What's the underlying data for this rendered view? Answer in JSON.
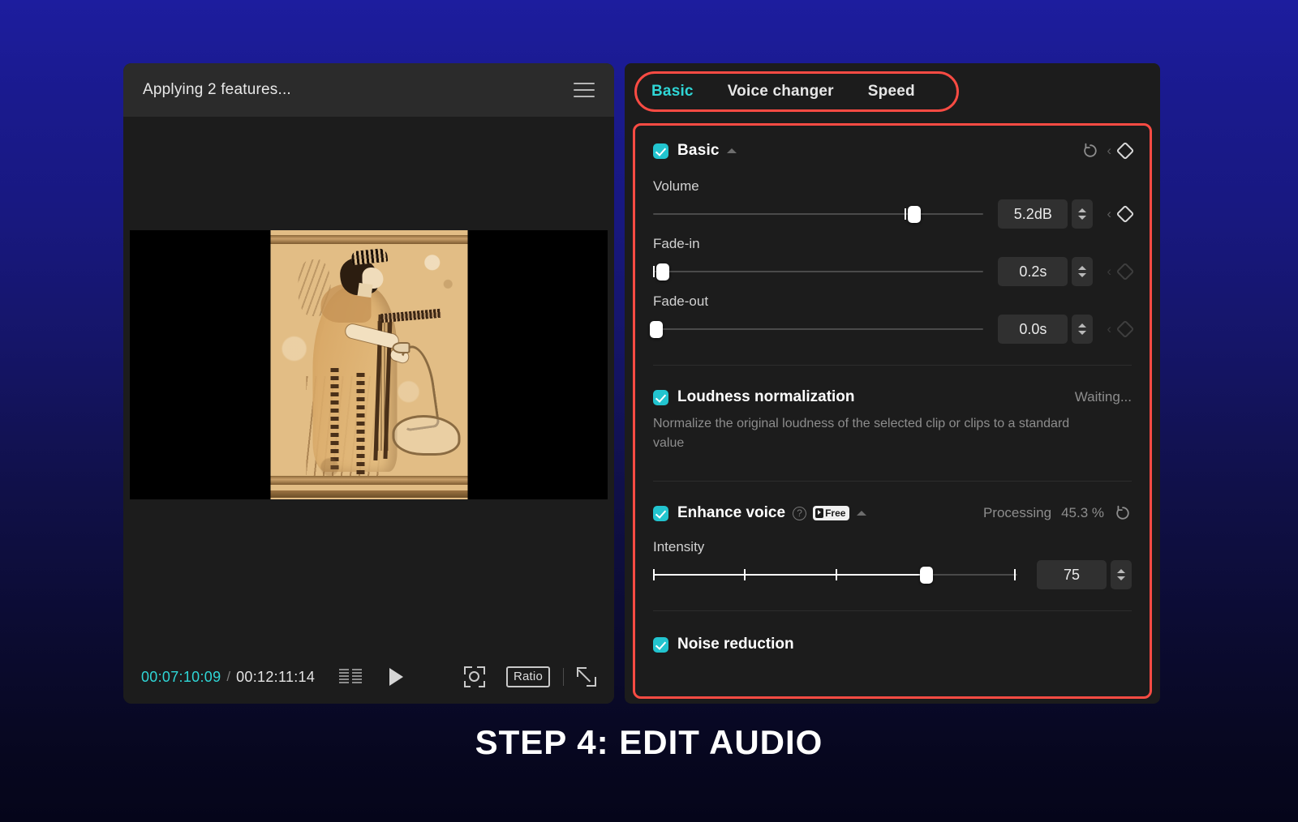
{
  "caption": "STEP 4: EDIT AUDIO",
  "player": {
    "title": "Applying 2 features...",
    "menu_icon": "hamburger-menu-icon",
    "current_time": "00:07:10:09",
    "time_separator": "/",
    "total_time": "00:12:11:14",
    "grid_icon": "grid-view-icon",
    "play_icon": "play-icon",
    "snapshot_icon": "snapshot-zoom-icon",
    "ratio_label": "Ratio",
    "fullscreen_icon": "fullscreen-expand-icon"
  },
  "properties": {
    "tabs": [
      {
        "label": "Basic",
        "active": true
      },
      {
        "label": "Voice changer",
        "active": false
      },
      {
        "label": "Speed",
        "active": false
      }
    ],
    "basic_section": {
      "title": "Basic",
      "checked": true,
      "collapse_icon": "caret-up-icon",
      "reset_icon": "reset-icon",
      "prev_keyframe_icon": "chevron-left-icon",
      "keyframe_icon": "keyframe-diamond-icon"
    },
    "controls": [
      {
        "label": "Volume",
        "value": "5.2dB",
        "slider_percent": 79,
        "tick_percent": 76,
        "keyframe_active": true
      },
      {
        "label": "Fade-in",
        "value": "0.2s",
        "slider_percent": 3,
        "tick_percent": 0,
        "keyframe_active": false
      },
      {
        "label": "Fade-out",
        "value": "0.0s",
        "slider_percent": 0,
        "tick_percent": 0,
        "keyframe_active": false
      }
    ],
    "loudness": {
      "title": "Loudness normalization",
      "checked": true,
      "status": "Waiting...",
      "description": "Normalize the original loudness of the selected clip or clips to a standard value"
    },
    "enhance_voice": {
      "title": "Enhance voice",
      "checked": true,
      "help_icon": "help-question-icon",
      "badge": "Free",
      "badge_icon": "bolt-icon",
      "collapse_icon": "caret-up-icon",
      "status": "Processing",
      "percent": "45.3 %",
      "reset_icon": "reset-icon",
      "intensity": {
        "label": "Intensity",
        "value": "75",
        "slider_percent": 75,
        "ticks": [
          0,
          25,
          50,
          100
        ]
      }
    },
    "noise_reduction": {
      "title": "Noise reduction",
      "checked": true
    }
  },
  "colors": {
    "accent_cyan": "#2fd6d6",
    "highlight_red": "#fa4b43",
    "checkbox_teal": "#22c4cf",
    "panel_bg": "#1c1c1c",
    "titlebar_bg": "#2b2b2b"
  }
}
